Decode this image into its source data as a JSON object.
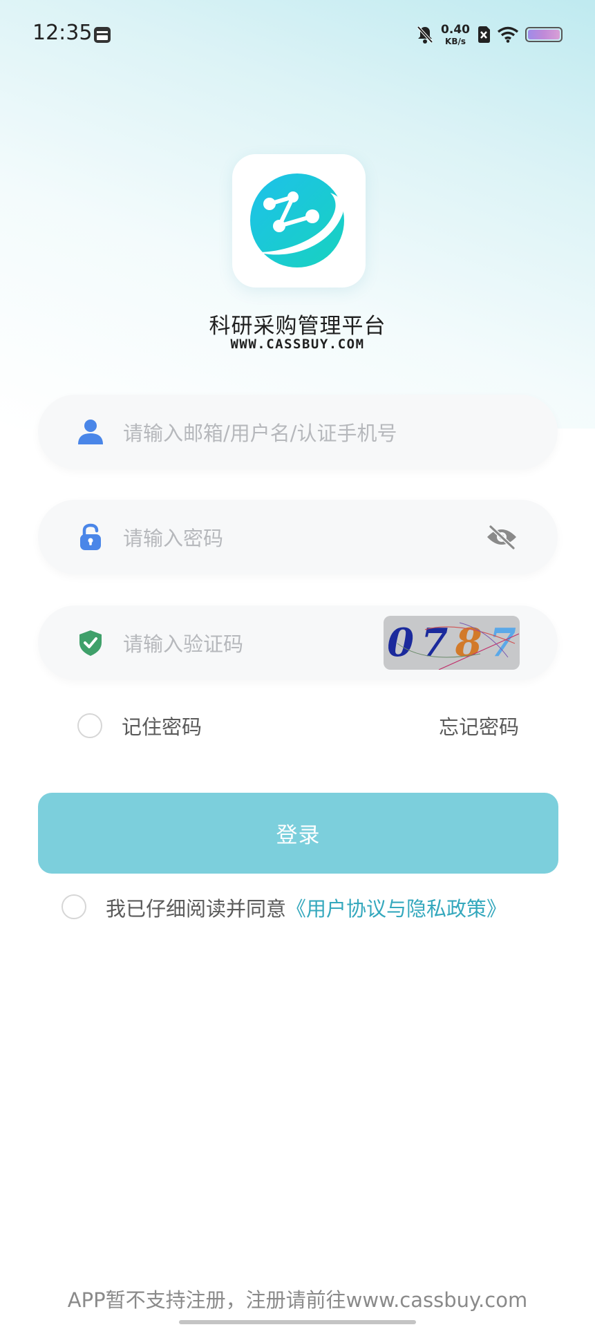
{
  "status_bar": {
    "time": "12:35",
    "net_speed_value": "0.40",
    "net_speed_unit": "KB/s",
    "icons": [
      "calendar-icon",
      "mute-bell-icon",
      "sim-off-icon",
      "wifi-icon",
      "battery-icon"
    ]
  },
  "app": {
    "title": "科研采购管理平台",
    "domain": "WWW.CASSBUY.COM",
    "logo_icon": "molecule-logo-icon"
  },
  "login_form": {
    "username_placeholder": "请输入邮箱/用户名/认证手机号",
    "password_placeholder": "请输入密码",
    "captcha_placeholder": "请输入验证码",
    "captcha_code": [
      "0",
      "7",
      "8",
      "7"
    ],
    "remember_label": "记住密码",
    "forgot_label": "忘记密码",
    "login_button": "登录",
    "agree_prefix": "我已仔细阅读并同意",
    "agree_link": "《用户协议与隐私政策》"
  },
  "footer": {
    "note": "APP暂不支持注册，注册请前往www.cassbuy.com"
  },
  "colors": {
    "accent": "#34a8bd",
    "button": "#7ccfdc",
    "icon_blue": "#4a86e8",
    "icon_green": "#3fa06a"
  }
}
